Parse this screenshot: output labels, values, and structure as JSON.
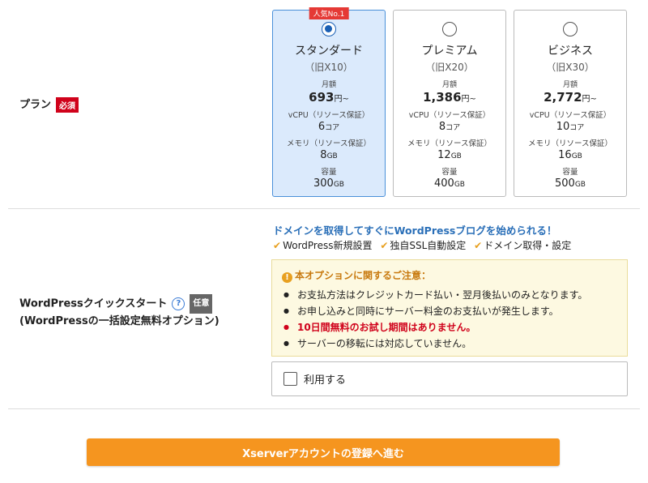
{
  "plan_section": {
    "label": "プラン",
    "required_badge": "必須",
    "plans": [
      {
        "name": "スタンダード",
        "old_name": "（旧X10）",
        "popular_badge": "人気No.1",
        "selected": true,
        "monthly_label": "月額",
        "price": "693",
        "price_unit": "円~",
        "vcpu_label": "vCPU（リソース保証）",
        "vcpu_value": "6",
        "vcpu_unit": "コア",
        "memory_label": "メモリ（リソース保証）",
        "memory_value": "8",
        "memory_unit": "GB",
        "storage_label": "容量",
        "storage_value": "300",
        "storage_unit": "GB"
      },
      {
        "name": "プレミアム",
        "old_name": "（旧X20）",
        "selected": false,
        "monthly_label": "月額",
        "price": "1,386",
        "price_unit": "円~",
        "vcpu_label": "vCPU（リソース保証）",
        "vcpu_value": "8",
        "vcpu_unit": "コア",
        "memory_label": "メモリ（リソース保証）",
        "memory_value": "12",
        "memory_unit": "GB",
        "storage_label": "容量",
        "storage_value": "400",
        "storage_unit": "GB"
      },
      {
        "name": "ビジネス",
        "old_name": "（旧X30）",
        "selected": false,
        "monthly_label": "月額",
        "price": "2,772",
        "price_unit": "円~",
        "vcpu_label": "vCPU（リソース保証）",
        "vcpu_value": "10",
        "vcpu_unit": "コア",
        "memory_label": "メモリ（リソース保証）",
        "memory_value": "16",
        "memory_unit": "GB",
        "storage_label": "容量",
        "storage_value": "500",
        "storage_unit": "GB"
      }
    ]
  },
  "wp_section": {
    "label_line1": "WordPressクイックスタート",
    "help_icon": "?",
    "optional_badge": "任意",
    "label_line2": "(WordPressの一括設定無料オプション)",
    "promo_title": "ドメインを取得してすぐにWordPressブログを始められる！",
    "features": [
      "WordPress新規設置",
      "独自SSL自動設定",
      "ドメイン取得・設定"
    ],
    "notice_title": "本オプションに関するご注意：",
    "notice_items": [
      "お支払方法はクレジットカード払い・翌月後払いのみとなります。",
      "お申し込みと同時にサーバー料金のお支払いが発生します。",
      "10日間無料のお試し期間はありません。",
      "サーバーの移転には対応していません。"
    ],
    "use_label": "利用する",
    "use_checked": false
  },
  "submit_label": "Xserverアカウントの登録へ進む",
  "colors": {
    "accent_orange": "#f5951f",
    "selected_bg": "#dbeafc",
    "required_red": "#d0021b",
    "promo_blue": "#2a6fb8"
  }
}
